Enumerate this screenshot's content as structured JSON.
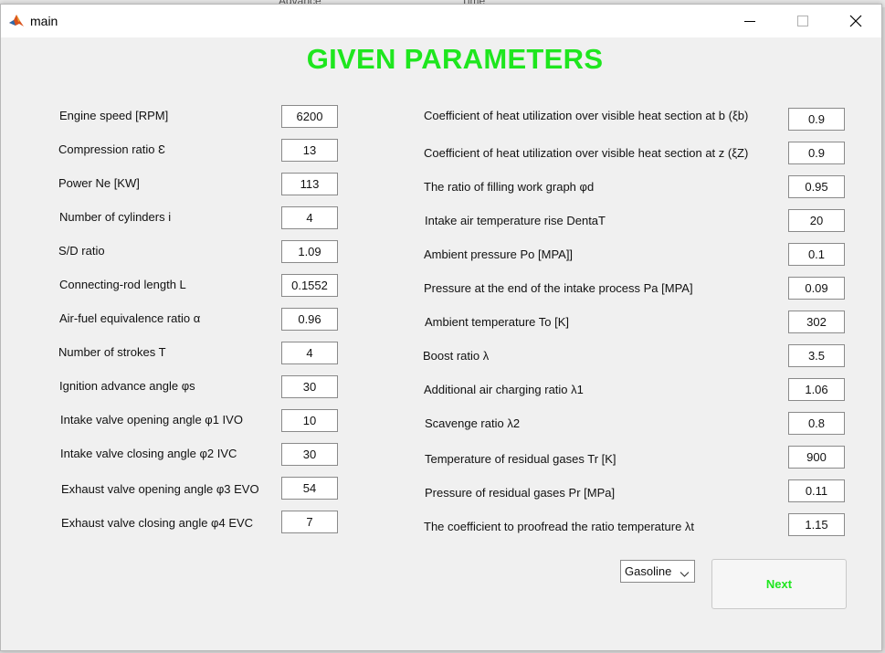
{
  "window": {
    "title": "main"
  },
  "heading": "GIVEN PARAMETERS",
  "left_params": [
    {
      "label": "Engine speed [RPM]",
      "value": "6200"
    },
    {
      "label": "Compression ratio Ɛ",
      "value": "13"
    },
    {
      "label": "Power Ne [KW]",
      "value": "113"
    },
    {
      "label": "Number of cylinders i",
      "value": "4"
    },
    {
      "label": "S/D ratio",
      "value": "1.09"
    },
    {
      "label": "Connecting-rod length L",
      "value": "0.1552"
    },
    {
      "label": "Air-fuel equivalence ratio α",
      "value": "0.96"
    },
    {
      "label": "Number of strokes T",
      "value": "4"
    },
    {
      "label": "Ignition advance angle φs",
      "value": "30"
    },
    {
      "label": "Intake valve opening angle φ1 IVO",
      "value": "10"
    },
    {
      "label": "Intake valve closing angle φ2 IVC",
      "value": "30"
    },
    {
      "label": "Exhaust valve opening angle φ3 EVO",
      "value": "54"
    },
    {
      "label": "Exhaust valve closing angle φ4 EVC",
      "value": "7"
    }
  ],
  "right_params": [
    {
      "label": "Coefficient of heat utilization over visible heat section at b (ξb)",
      "value": "0.9"
    },
    {
      "label": "Coefficient of heat utilization over visible heat section at z (ξZ)",
      "value": "0.9"
    },
    {
      "label": "The ratio of filling work graph φd",
      "value": "0.95"
    },
    {
      "label": "Intake air temperature rise DentaT",
      "value": "20"
    },
    {
      "label": "Ambient pressure Po [MPA]]",
      "value": "0.1"
    },
    {
      "label": "Pressure at the end of the intake process Pa [MPA]",
      "value": "0.09"
    },
    {
      "label": "Ambient temperature  To [K]",
      "value": "302"
    },
    {
      "label": "Boost ratio λ",
      "value": "3.5"
    },
    {
      "label": "Additional air charging ratio λ1",
      "value": "1.06"
    },
    {
      "label": "Scavenge ratio λ2",
      "value": "0.8"
    },
    {
      "label": "Temperature of residual gases Tr [K]",
      "value": "900"
    },
    {
      "label": "Pressure of residual gases Pr [MPa]",
      "value": "0.11"
    },
    {
      "label": "The coefficient to proofread the ratio temperature λt",
      "value": "1.15"
    }
  ],
  "fuel_select": {
    "value": "Gasoline"
  },
  "next_button": {
    "label": "Next"
  },
  "background_window": {
    "columns": [
      "Advance",
      "Time"
    ]
  },
  "colors": {
    "heading": "#1ee61e",
    "next_text": "#1ee61e",
    "window_bg": "#f0f0f0"
  },
  "icons": [
    "matlab-icon",
    "minimize-icon",
    "maximize-icon",
    "close-icon",
    "chevron-down-icon"
  ]
}
